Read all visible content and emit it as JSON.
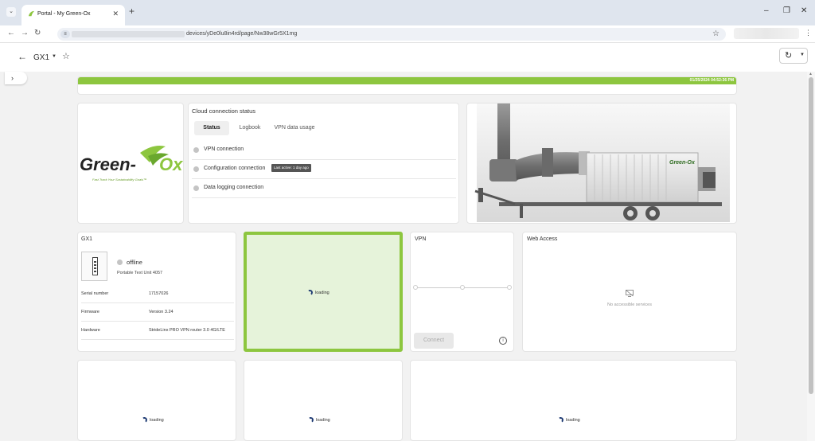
{
  "browser": {
    "tab_title": "Portal - My Green-Ox",
    "url_path": "devices/yDe0lu8in4rd/page/Nw38wGr5X1mg"
  },
  "header": {
    "device_name": "GX1"
  },
  "status": {
    "timestamp": "01/25/2024 04:52:36 PM",
    "bar_color": "#8dc63f"
  },
  "logo": {
    "brand": "Green-Ox",
    "tagline": "Fast Track Your Sustainability Goals™"
  },
  "cloud": {
    "title": "Cloud connection status",
    "tabs": [
      "Status",
      "Logbook",
      "VPN data usage"
    ],
    "active_tab": "Status",
    "rows": [
      {
        "label": "VPN connection"
      },
      {
        "label": "Configuration connection",
        "badge": "Last active: 1 day ago"
      },
      {
        "label": "Data logging connection"
      }
    ]
  },
  "device": {
    "title": "GX1",
    "state": "offline",
    "unit": "Portable Text Unit 4057",
    "fields": [
      {
        "key": "Serial number",
        "value": "17157026"
      },
      {
        "key": "Firmware",
        "value": "Version 3.24"
      },
      {
        "key": "Hardware",
        "value": "StrideLinx PRO VPN router 3.0 4G/LTE"
      }
    ]
  },
  "loading_label": "loading",
  "vpn": {
    "title": "VPN",
    "connect_label": "Connect",
    "info_glyph": "i"
  },
  "web_access": {
    "title": "Web Access",
    "empty_text": "No accessible services"
  },
  "container_label": "Green-Ox"
}
